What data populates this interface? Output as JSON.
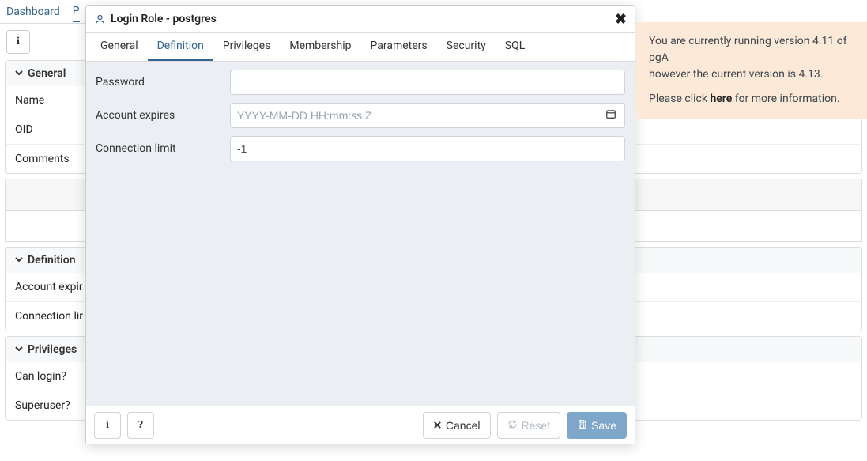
{
  "bg_tabs": {
    "dashboard": "Dashboard",
    "properties_initial": "P"
  },
  "info_char": "i",
  "bg_panels": {
    "general": {
      "title": "General",
      "fields": [
        "Name",
        "OID",
        "Comments"
      ]
    },
    "definition": {
      "title": "Definition",
      "fields": [
        "Account expir",
        "Connection lir"
      ]
    },
    "privileges": {
      "title": "Privileges",
      "fields": [
        "Can login?",
        "Superuser?"
      ]
    }
  },
  "modal": {
    "title": "Login Role - postgres",
    "tabs": [
      "General",
      "Definition",
      "Privileges",
      "Membership",
      "Parameters",
      "Security",
      "SQL"
    ],
    "active_tab": "Definition",
    "fields": {
      "password": {
        "label": "Password",
        "value": ""
      },
      "account_expires": {
        "label": "Account expires",
        "value": "",
        "placeholder": "YYYY-MM-DD HH:mm:ss Z"
      },
      "connection_limit": {
        "label": "Connection limit",
        "value": "-1"
      }
    },
    "footer": {
      "info": "i",
      "help": "?",
      "cancel": "Cancel",
      "reset": "Reset",
      "save": "Save"
    }
  },
  "toast": {
    "line1_a": "You are currently running version 4.11 of pgA",
    "line1_b": "however the current version is 4.13.",
    "line2_a": "Please click ",
    "here": "here",
    "line2_b": " for more information."
  }
}
